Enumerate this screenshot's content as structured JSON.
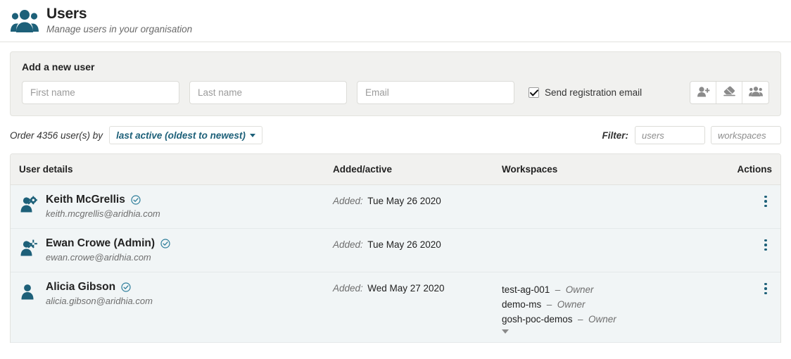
{
  "header": {
    "icon": "users-group-icon",
    "title": "Users",
    "subtitle": "Manage users in your organisation"
  },
  "add_panel": {
    "title": "Add a new user",
    "first_name": {
      "value": "",
      "placeholder": "First name"
    },
    "last_name": {
      "value": "",
      "placeholder": "Last name"
    },
    "email": {
      "value": "",
      "placeholder": "Email"
    },
    "send_registration_email": {
      "label": "Send registration email",
      "checked": true
    },
    "buttons": [
      {
        "name": "add-user-button",
        "icon": "user-plus-icon"
      },
      {
        "name": "clear-form-button",
        "icon": "eraser-icon"
      },
      {
        "name": "bulk-add-users-button",
        "icon": "users-group-icon"
      }
    ]
  },
  "order_bar": {
    "prefix": "Order",
    "count": "4356",
    "suffix": "user(s) by",
    "full_label": "Order 4356 user(s) by",
    "sort_value": "last active (oldest to newest)",
    "filter_label": "Filter:",
    "filter_users": {
      "value": "",
      "placeholder": "users"
    },
    "filter_workspaces": {
      "value": "",
      "placeholder": "workspaces"
    }
  },
  "table": {
    "columns": [
      "User details",
      "Added/active",
      "Workspaces",
      "Actions"
    ],
    "rows": [
      {
        "icon": "user-cog-icon",
        "name": "Keith McGrellis",
        "verified": true,
        "email": "keith.mcgrellis@aridhia.com",
        "added_label": "Added:",
        "added_value": "Tue May 26 2020",
        "workspaces": [],
        "has_more_workspaces": false
      },
      {
        "icon": "user-cog-icon",
        "name": "Ewan Crowe (Admin)",
        "verified": true,
        "email": "ewan.crowe@aridhia.com",
        "added_label": "Added:",
        "added_value": "Tue May 26 2020",
        "workspaces": [],
        "has_more_workspaces": false
      },
      {
        "icon": "user-icon",
        "name": "Alicia Gibson",
        "verified": true,
        "email": "alicia.gibson@aridhia.com",
        "added_label": "Added:",
        "added_value": "Wed May 27 2020",
        "workspaces": [
          {
            "name": "test-ag-001",
            "role": "Owner"
          },
          {
            "name": "demo-ms",
            "role": "Owner"
          },
          {
            "name": "gosh-poc-demos",
            "role": "Owner"
          }
        ],
        "has_more_workspaces": true
      }
    ],
    "role_separator": "–"
  },
  "colors": {
    "accent": "#1d6079",
    "panel_bg": "#f1f1ef",
    "row_bg": "#f1f5f6",
    "border": "#e2e2de",
    "muted_text": "#6e6e6e"
  }
}
